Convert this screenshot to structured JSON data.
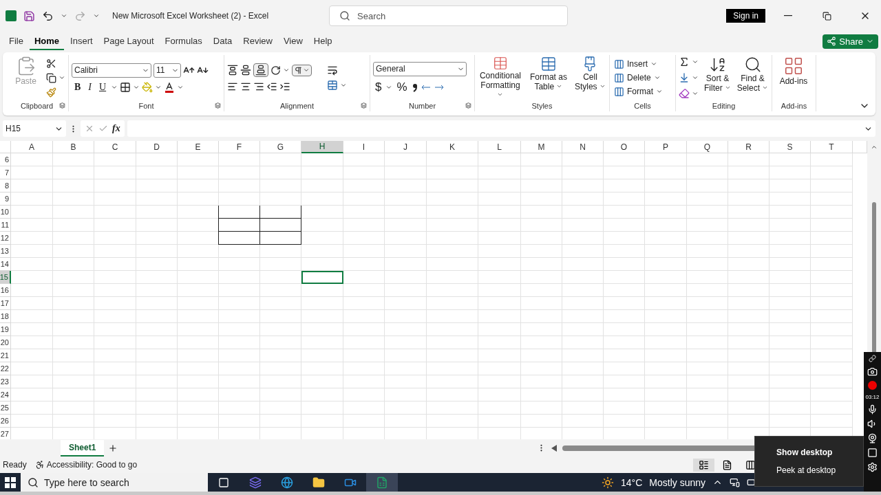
{
  "title_bar": {
    "title": "New Microsoft Excel Worksheet (2)  -  Excel",
    "search_placeholder": "Search",
    "sign_in": "Sign in"
  },
  "menu_tabs": [
    {
      "label": "File",
      "selected": false
    },
    {
      "label": "Home",
      "selected": true
    },
    {
      "label": "Insert",
      "selected": false
    },
    {
      "label": "Page Layout",
      "selected": false
    },
    {
      "label": "Formulas",
      "selected": false
    },
    {
      "label": "Data",
      "selected": false
    },
    {
      "label": "Review",
      "selected": false
    },
    {
      "label": "View",
      "selected": false
    },
    {
      "label": "Help",
      "selected": false
    }
  ],
  "share": "Share",
  "ribbon": {
    "clipboard": {
      "paste": "Paste",
      "label": "Clipboard"
    },
    "font": {
      "font_name": "Calibri",
      "font_size": "11",
      "bold": "B",
      "italic": "I",
      "underline": "U",
      "label": "Font"
    },
    "alignment": {
      "label": "Alignment"
    },
    "number": {
      "format": "General",
      "currency": "$",
      "percent": "%",
      "label": "Number"
    },
    "styles": {
      "buttons": [
        "Conditional Formatting",
        "Format as Table",
        "Cell Styles"
      ],
      "label": "Styles"
    },
    "cells": {
      "buttons": [
        "Insert",
        "Delete",
        "Format"
      ],
      "label": "Cells"
    },
    "editing": {
      "buttons": [
        "Sort & Filter",
        "Find & Select"
      ],
      "label": "Editing"
    },
    "addins": {
      "button": "Add-ins",
      "label": "Add-ins"
    }
  },
  "formula_bar": {
    "name_box": "H15",
    "fx": "fx"
  },
  "sheet": {
    "columns": [
      {
        "label": "A",
        "selected": false,
        "bordered": false
      },
      {
        "label": "B",
        "selected": false,
        "bordered": false
      },
      {
        "label": "C",
        "selected": false,
        "bordered": false
      },
      {
        "label": "D",
        "selected": false,
        "bordered": false
      },
      {
        "label": "E",
        "selected": false,
        "bordered": false
      },
      {
        "label": "F",
        "selected": false,
        "bordered": true
      },
      {
        "label": "G",
        "selected": false,
        "bordered": true
      },
      {
        "label": "H",
        "selected": true,
        "bordered": false
      },
      {
        "label": "I",
        "selected": false,
        "bordered": false
      },
      {
        "label": "J",
        "selected": false,
        "bordered": false
      },
      {
        "label": "K",
        "selected": false,
        "bordered": false
      },
      {
        "label": "L",
        "selected": false,
        "bordered": false
      },
      {
        "label": "M",
        "selected": false,
        "bordered": false
      },
      {
        "label": "N",
        "selected": false,
        "bordered": false
      },
      {
        "label": "O",
        "selected": false,
        "bordered": false
      },
      {
        "label": "P",
        "selected": false,
        "bordered": false
      },
      {
        "label": "Q",
        "selected": false,
        "bordered": false
      },
      {
        "label": "R",
        "selected": false,
        "bordered": false
      },
      {
        "label": "S",
        "selected": false,
        "bordered": false
      },
      {
        "label": "T",
        "selected": false,
        "bordered": false
      }
    ],
    "rows": [
      {
        "label": "6",
        "selected": false,
        "bordered": false
      },
      {
        "label": "7",
        "selected": false,
        "bordered": false
      },
      {
        "label": "8",
        "selected": false,
        "bordered": false
      },
      {
        "label": "9",
        "selected": false,
        "bordered": false
      },
      {
        "label": "10",
        "selected": false,
        "bordered": true
      },
      {
        "label": "11",
        "selected": false,
        "bordered": true
      },
      {
        "label": "12",
        "selected": false,
        "bordered": true
      },
      {
        "label": "13",
        "selected": false,
        "bordered": false
      },
      {
        "label": "14",
        "selected": false,
        "bordered": false
      },
      {
        "label": "15",
        "selected": true,
        "bordered": false
      },
      {
        "label": "16",
        "selected": false,
        "bordered": false
      },
      {
        "label": "17",
        "selected": false,
        "bordered": false
      },
      {
        "label": "18",
        "selected": false,
        "bordered": false
      },
      {
        "label": "19",
        "selected": false,
        "bordered": false
      },
      {
        "label": "20",
        "selected": false,
        "bordered": false
      },
      {
        "label": "21",
        "selected": false,
        "bordered": false
      },
      {
        "label": "22",
        "selected": false,
        "bordered": false
      },
      {
        "label": "23",
        "selected": false,
        "bordered": false
      },
      {
        "label": "24",
        "selected": false,
        "bordered": false
      },
      {
        "label": "25",
        "selected": false,
        "bordered": false
      },
      {
        "label": "26",
        "selected": false,
        "bordered": false
      },
      {
        "label": "27",
        "selected": false,
        "bordered": false
      }
    ]
  },
  "sheet_tabs": [
    {
      "label": "Sheet1",
      "selected": true
    }
  ],
  "status_bar": {
    "mode": "Ready",
    "accessibility": "Accessibility: Good to go"
  },
  "taskbar": {
    "search_placeholder": "Type here to search",
    "temperature": "14°C",
    "weather": "Mostly sunny"
  },
  "recorder": {
    "timer": "03:12"
  },
  "desktop_menu": {
    "items": [
      "Show desktop",
      "Peek at desktop"
    ]
  }
}
